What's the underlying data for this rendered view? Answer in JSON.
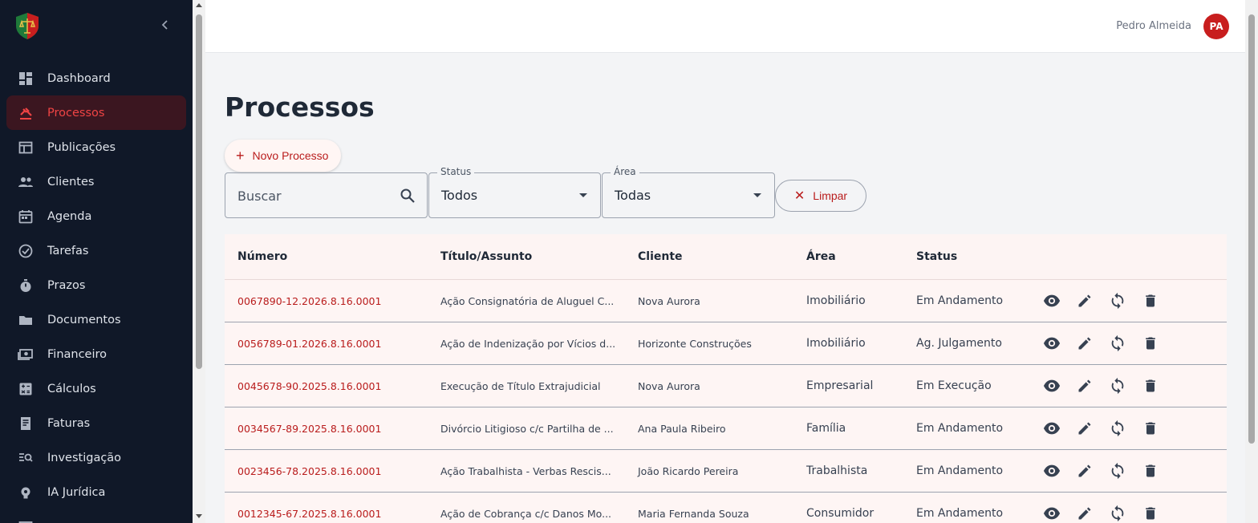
{
  "user": {
    "name": "Pedro Almeida",
    "initials": "PA"
  },
  "sidebar": {
    "items": [
      {
        "label": "Dashboard",
        "icon": "dashboard-icon"
      },
      {
        "label": "Processos",
        "icon": "gavel-icon",
        "active": true
      },
      {
        "label": "Publicações",
        "icon": "newspaper-icon"
      },
      {
        "label": "Clientes",
        "icon": "people-icon"
      },
      {
        "label": "Agenda",
        "icon": "calendar-icon"
      },
      {
        "label": "Tarefas",
        "icon": "check-circle-icon"
      },
      {
        "label": "Prazos",
        "icon": "stopwatch-icon"
      },
      {
        "label": "Documentos",
        "icon": "folder-icon"
      },
      {
        "label": "Financeiro",
        "icon": "money-icon"
      },
      {
        "label": "Cálculos",
        "icon": "calculator-icon"
      },
      {
        "label": "Faturas",
        "icon": "receipt-icon"
      },
      {
        "label": "Investigação",
        "icon": "search-list-icon"
      },
      {
        "label": "IA Jurídica",
        "icon": "ai-bulb-icon"
      }
    ]
  },
  "page": {
    "title": "Processos",
    "new_button": "Novo Processo"
  },
  "filters": {
    "search_placeholder": "Buscar",
    "status_label": "Status",
    "status_value": "Todos",
    "area_label": "Área",
    "area_value": "Todas",
    "clear_button": "Limpar"
  },
  "table": {
    "headers": {
      "numero": "Número",
      "titulo": "Título/Assunto",
      "cliente": "Cliente",
      "area": "Área",
      "status": "Status"
    },
    "rows": [
      {
        "numero": "0067890-12.2026.8.16.0001",
        "titulo": "Ação Consignatória de Aluguel C...",
        "cliente": "Nova Aurora",
        "area": "Imobiliário",
        "status": "Em Andamento"
      },
      {
        "numero": "0056789-01.2026.8.16.0001",
        "titulo": "Ação de Indenização por Vícios d...",
        "cliente": "Horizonte Construções",
        "area": "Imobiliário",
        "status": "Ag. Julgamento"
      },
      {
        "numero": "0045678-90.2025.8.16.0001",
        "titulo": "Execução de Título Extrajudicial",
        "cliente": "Nova Aurora",
        "area": "Empresarial",
        "status": "Em Execução"
      },
      {
        "numero": "0034567-89.2025.8.16.0001",
        "titulo": "Divórcio Litigioso c/c Partilha de ...",
        "cliente": "Ana Paula Ribeiro",
        "area": "Família",
        "status": "Em Andamento"
      },
      {
        "numero": "0023456-78.2025.8.16.0001",
        "titulo": "Ação Trabalhista - Verbas Rescis...",
        "cliente": "João Ricardo Pereira",
        "area": "Trabalhista",
        "status": "Em Andamento"
      },
      {
        "numero": "0012345-67.2025.8.16.0001",
        "titulo": "Ação de Cobrança c/c Danos Mo...",
        "cliente": "Maria Fernanda Souza",
        "area": "Consumidor",
        "status": "Em Andamento"
      }
    ],
    "actions": [
      "view-icon",
      "edit-icon",
      "sync-icon",
      "delete-icon"
    ]
  },
  "colors": {
    "accent": "#b91c1c",
    "sidebar_bg": "#101828",
    "active_bg": "#3b1620",
    "table_bg": "#fdf4f3"
  }
}
